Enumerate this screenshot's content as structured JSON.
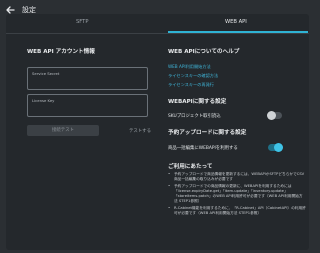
{
  "header": {
    "title": "設定"
  },
  "tabs": [
    {
      "label": "SFTP"
    },
    {
      "label": "WEB API"
    }
  ],
  "account": {
    "heading": "WEB API アカウント情報",
    "secret_label": "Service Secret",
    "key_label": "License Key",
    "save_label": "接続テスト",
    "test_label": "テストする"
  },
  "help": {
    "heading": "WEB APIについてのヘルプ",
    "links": [
      "WEB API利用開始方法",
      "ライセンスキーの確認方法",
      "ライセンスキーの再発行"
    ]
  },
  "webapi_settings": {
    "heading": "WEBAPIに関する設定",
    "toggle_label": "SKUプロジェクト取引読込",
    "toggle_on": false
  },
  "reservation_settings": {
    "heading": "予約アップロードに関する設定",
    "toggle_label": "商品一括編集にWEBAPIを利用する",
    "toggle_on": true
  },
  "notes": {
    "heading": "ご利用にあたって",
    "items": [
      "予約アップロードで商品情報を更新するには、WEBAPIかSFTPどちらかでCSV商品一括編集の取り込みが必要です",
      "予約アップロードでの商品情報の更新に、WEBAPIを利用するためには「license.expiryDate.get」「item.update」「inventory.update」「storeitems.patch」のWEB API利用許可が必要です（WEB API利用開始方法 STEP1参照）",
      "R-Cabinet機能を利用するために、「R-Cabinet」API（CabinetAPI）の利用許可が必要です（WEB API利用開始方法 STEP1参照）"
    ]
  }
}
